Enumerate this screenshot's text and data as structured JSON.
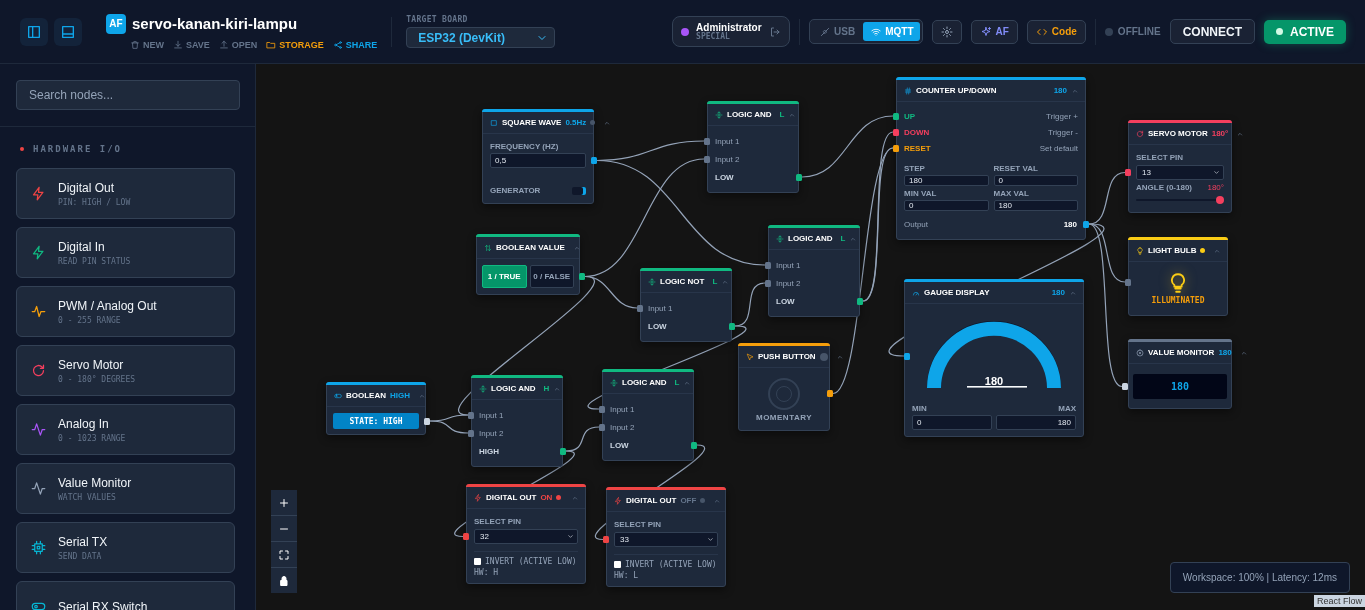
{
  "header": {
    "logo": "AF",
    "project_title": "servo-kanan-kiri-lampu",
    "actions": [
      {
        "label": "NEW",
        "kind": "new"
      },
      {
        "label": "SAVE",
        "kind": "save"
      },
      {
        "label": "OPEN",
        "kind": "open"
      },
      {
        "label": "STORAGE",
        "kind": "storage"
      },
      {
        "label": "SHARE",
        "kind": "share"
      }
    ],
    "target_board": {
      "label": "TARGET BOARD",
      "value": "ESP32 (DevKit)"
    },
    "user": {
      "name": "Administrator",
      "role": "SPECIAL"
    },
    "transport": [
      {
        "label": "USB",
        "kind": "usb",
        "selected": false
      },
      {
        "label": "MQTT",
        "kind": "wifi",
        "selected": true
      }
    ],
    "ai_button": "AF",
    "code_button": "Code",
    "connection": {
      "status": "OFFLINE",
      "online": false
    },
    "connect_button": "CONNECT",
    "active_button": {
      "label": "ACTIVE",
      "on": true
    }
  },
  "sidebar": {
    "search": {
      "placeholder": "Search nodes..."
    },
    "section": "HARDWARE I/O",
    "items": [
      {
        "title": "Digital Out",
        "subtitle": "PIN: HIGH / LOW",
        "kind": "bolt",
        "color": "#ef4444"
      },
      {
        "title": "Digital In",
        "subtitle": "READ PIN STATUS",
        "kind": "bolt",
        "color": "#10b981"
      },
      {
        "title": "PWM / Analog Out",
        "subtitle": "0 - 255 RANGE",
        "kind": "pulse",
        "color": "#f59e0b"
      },
      {
        "title": "Servo Motor",
        "subtitle": "0 - 180° DEGREES",
        "kind": "rotate",
        "color": "#f43f5e"
      },
      {
        "title": "Analog In",
        "subtitle": "0 - 1023 RANGE",
        "kind": "activity",
        "color": "#a855f7"
      },
      {
        "title": "Value Monitor",
        "subtitle": "WATCH VALUES",
        "kind": "activity",
        "color": "#94a3b8"
      },
      {
        "title": "Serial TX",
        "subtitle": "SEND DATA",
        "kind": "chip",
        "color": "#06b6d4"
      },
      {
        "title": "Serial RX Switch",
        "kind": "toggle",
        "color": "#06b6d4"
      }
    ]
  },
  "canvas": {
    "nodes": [
      {
        "kind": "square_wave",
        "title": "SQUARE WAVE",
        "badge": "0.5Hz",
        "color": "#0ea5e9",
        "field_label": "FREQUENCY (HZ)",
        "value": "0,5",
        "footer": "GENERATOR",
        "on": true
      },
      {
        "kind": "logic",
        "title": "LOGIC AND",
        "badge": "L",
        "color": "#10b981",
        "inputs": [
          "Input 1",
          "Input 2"
        ],
        "output": "LOW"
      },
      {
        "kind": "counter",
        "title": "COUNTER UP/DOWN",
        "badge": "180",
        "color": "#0ea5e9",
        "ports": [
          {
            "label": "UP",
            "hint": "Trigger +",
            "color": "#10b981"
          },
          {
            "label": "DOWN",
            "hint": "Trigger -",
            "color": "#f43f5e"
          },
          {
            "label": "RESET",
            "hint": "Set default",
            "color": "#f59e0b"
          }
        ],
        "fields": [
          {
            "label": "STEP",
            "value": "180"
          },
          {
            "label": "RESET VAL",
            "value": "0"
          },
          {
            "label": "MIN VAL",
            "value": "0"
          },
          {
            "label": "MAX VAL",
            "value": "180"
          }
        ],
        "output_label": "Output",
        "output_value": "180"
      },
      {
        "kind": "servo",
        "title": "SERVO MOTOR",
        "badge": "180°",
        "color": "#f43f5e",
        "pin_label": "SELECT PIN",
        "pin": "13",
        "angle_label": "ANGLE (0-180)",
        "angle_reading": "180°",
        "level": 1
      },
      {
        "kind": "boolean_value",
        "title": "BOOLEAN VALUE",
        "color": "#10b981",
        "options": [
          {
            "label": "1 / TRUE",
            "selected": true
          },
          {
            "label": "0 / FALSE",
            "selected": false
          }
        ]
      },
      {
        "kind": "logic",
        "title": "LOGIC AND",
        "badge": "L",
        "color": "#10b981",
        "inputs": [
          "Input 1",
          "Input 2"
        ],
        "output": "LOW"
      },
      {
        "kind": "logic",
        "title": "LOGIC NOT",
        "badge": "L",
        "color": "#10b981",
        "inputs": [
          "Input 1"
        ],
        "output": "LOW"
      },
      {
        "kind": "gauge",
        "title": "GAUGE DISPLAY",
        "badge": "180",
        "color": "#0ea5e9",
        "value": "180",
        "level": 1,
        "min_label": "MIN",
        "min": "0",
        "max_label": "MAX",
        "max": "180"
      },
      {
        "kind": "bulb",
        "title": "LIGHT BULB",
        "color": "#facc15",
        "on": true,
        "status": "ILLUMINATED"
      },
      {
        "kind": "monitor",
        "title": "VALUE MONITOR",
        "badge": "180",
        "color": "#64748b",
        "value": "180"
      },
      {
        "kind": "push_button",
        "title": "PUSH BUTTON",
        "color": "#f59e0b",
        "pressed": false,
        "caption": "MOMENTARY"
      },
      {
        "kind": "boolean",
        "title": "BOOLEAN",
        "badge": "HIGH",
        "color": "#0ea5e9",
        "button": "STATE: HIGH"
      },
      {
        "kind": "logic",
        "title": "LOGIC AND",
        "badge": "H",
        "color": "#10b981",
        "inputs": [
          "Input 1",
          "Input 2"
        ],
        "output": "HIGH"
      },
      {
        "kind": "logic",
        "title": "LOGIC AND",
        "badge": "L",
        "color": "#10b981",
        "inputs": [
          "Input 1",
          "Input 2"
        ],
        "output": "LOW"
      },
      {
        "kind": "digital_out",
        "title": "DIGITAL OUT",
        "badge": "ON",
        "on": true,
        "color": "#ef4444",
        "pin_label": "SELECT PIN",
        "pin": "32",
        "invert_label": "INVERT (ACTIVE LOW)",
        "checked": false,
        "hw": "HW: H"
      },
      {
        "kind": "digital_out",
        "title": "DIGITAL OUT",
        "badge": "OFF",
        "on": false,
        "color": "#ef4444",
        "pin_label": "SELECT PIN",
        "pin": "33",
        "invert_label": "INVERT (ACTIVE LOW)",
        "checked": false,
        "hw": "HW: L"
      }
    ],
    "status": "Workspace: 100% | Latency: 12ms",
    "attribution": "React Flow"
  }
}
